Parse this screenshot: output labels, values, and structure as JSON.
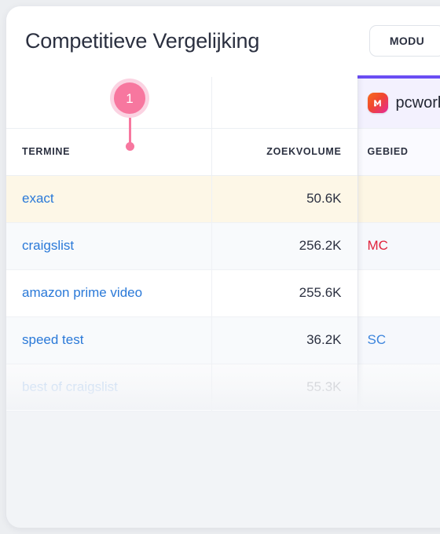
{
  "header": {
    "title": "Competitieve Vergelijking",
    "mode_button_label": "MODU"
  },
  "brand": {
    "name": "pcworld",
    "logo_icon": "pcworld-m-logo-icon",
    "accent_color": "#6a4df4"
  },
  "callout": {
    "number": "1"
  },
  "table": {
    "columns": [
      {
        "key": "term",
        "label": "TERMINE"
      },
      {
        "key": "volume",
        "label": "ZOEKVOLUME"
      },
      {
        "key": "area",
        "label": "GEBIED"
      }
    ],
    "rows": [
      {
        "term": "exact",
        "volume": "50.6K",
        "area": "",
        "area_kind": "none"
      },
      {
        "term": "craigslist",
        "volume": "256.2K",
        "area": "MC",
        "area_kind": "mc"
      },
      {
        "term": "amazon prime video",
        "volume": "255.6K",
        "area": "",
        "area_kind": "none"
      },
      {
        "term": "speed test",
        "volume": "36.2K",
        "area": "SC",
        "area_kind": "sc"
      },
      {
        "term": "best of craigslist",
        "volume": "55.3K",
        "area": "",
        "area_kind": "none"
      }
    ]
  },
  "colors": {
    "link": "#2a79d8",
    "area_mc": "#e0233c",
    "area_sc": "#3c85dd",
    "accent_purple": "#6a4df4",
    "callout_pink": "#f7779f",
    "row_highlight_cream": "#fdf7e7",
    "page_background": "#eceef1"
  }
}
